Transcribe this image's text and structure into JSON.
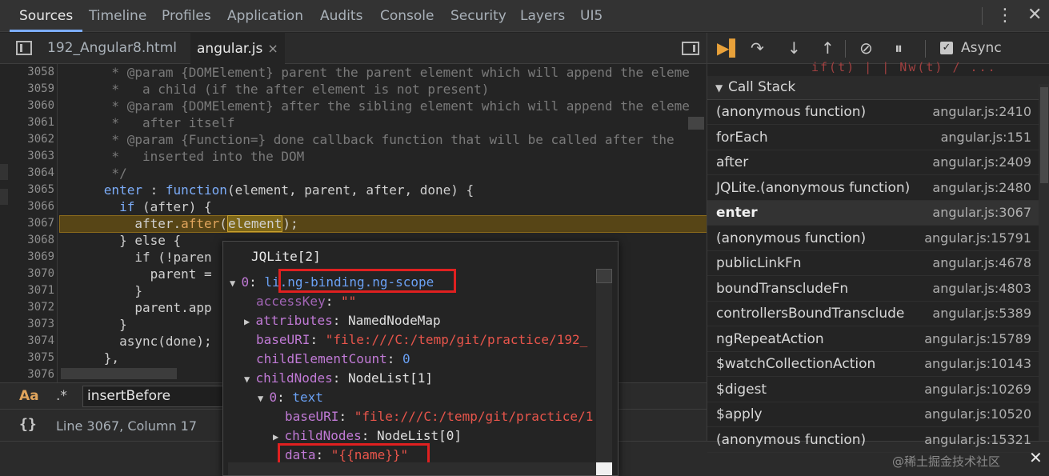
{
  "top_tabs": [
    "Sources",
    "Timeline",
    "Profiles",
    "Application",
    "Audits",
    "Console",
    "Security",
    "Layers",
    "UI5"
  ],
  "top_bar": {
    "menu_icon": "kebab-icon",
    "close_icon": "close-icon"
  },
  "editor": {
    "tabs": [
      {
        "label": "192_Angular8.html"
      },
      {
        "label": "angular.js",
        "close": "×"
      }
    ],
    "lines": [
      {
        "num": "3058",
        "text": "       * @param {DOMElement} parent the parent element which will append the eleme"
      },
      {
        "num": "3059",
        "text": "       *   a child (if the after element is not present)"
      },
      {
        "num": "3060",
        "text": "       * @param {DOMElement} after the sibling element which will append the eleme"
      },
      {
        "num": "3061",
        "text": "       *   after itself"
      },
      {
        "num": "3062",
        "text": "       * @param {Function=} done callback function that will be called after the"
      },
      {
        "num": "3063",
        "text": "       *   inserted into the DOM"
      },
      {
        "num": "3064",
        "text": "       */"
      },
      {
        "num": "3065",
        "text": ""
      },
      {
        "num": "3066",
        "text": ""
      },
      {
        "num": "3067",
        "text": ""
      },
      {
        "num": "3068",
        "text": "        } else {"
      },
      {
        "num": "3069",
        "text": "          if (!paren"
      },
      {
        "num": "3070",
        "text": "            parent ="
      },
      {
        "num": "3071",
        "text": "          }"
      },
      {
        "num": "3072",
        "text": "          parent.app"
      },
      {
        "num": "3073",
        "text": "        }"
      },
      {
        "num": "3074",
        "text": "        async(done);"
      },
      {
        "num": "3075",
        "text": "      },"
      },
      {
        "num": "3076",
        "text": ""
      }
    ],
    "line_3065": {
      "indent": "      ",
      "name": "enter",
      "sep": " : ",
      "kw": "function",
      "args": "(element, parent, after, done) {"
    },
    "line_3066": {
      "indent": "        ",
      "kw": "if",
      "rest": " (after) {"
    },
    "line_3067": {
      "indent": "          ",
      "obj": "after.",
      "method": "after",
      "open": "(",
      "arg": "element",
      "close": ");"
    }
  },
  "search": {
    "case_label": "Aa",
    "regex_label": ".*",
    "value": "insertBefore"
  },
  "status": {
    "braces": "{}",
    "cursor": "Line 3067, Column 17"
  },
  "debugger": {
    "async_label": "Async",
    "async_checked": "✓",
    "cut_off_text": "if(t) | | Nw(t) / ...",
    "call_stack_title": "Call Stack",
    "frames": [
      {
        "name": "(anonymous function)",
        "loc": "angular.js:2410"
      },
      {
        "name": "forEach",
        "loc": "angular.js:151"
      },
      {
        "name": "after",
        "loc": "angular.js:2409"
      },
      {
        "name": "JQLite.(anonymous function)",
        "loc": "angular.js:2480"
      },
      {
        "name": "enter",
        "loc": "angular.js:3067",
        "selected": true
      },
      {
        "name": "(anonymous function)",
        "loc": "angular.js:15791"
      },
      {
        "name": "publicLinkFn",
        "loc": "angular.js:4678"
      },
      {
        "name": "boundTranscludeFn",
        "loc": "angular.js:4803"
      },
      {
        "name": "controllersBoundTransclude",
        "loc": "angular.js:5389"
      },
      {
        "name": "ngRepeatAction",
        "loc": "angular.js:15789"
      },
      {
        "name": "$watchCollectionAction",
        "loc": "angular.js:10143"
      },
      {
        "name": "$digest",
        "loc": "angular.js:10269"
      },
      {
        "name": "$apply",
        "loc": "angular.js:10520"
      },
      {
        "name": "(anonymous function)",
        "loc": "angular.js:15321"
      }
    ]
  },
  "popover": {
    "title": "JQLite[2]",
    "rows": {
      "r0": {
        "key": "0",
        "colon": ": ",
        "val": "li.ng-binding.ng-scope"
      },
      "r1": {
        "key": "accessKey",
        "colon": ": ",
        "val": "\"\""
      },
      "r2": {
        "key": "attributes",
        "colon": ": ",
        "val": "NamedNodeMap"
      },
      "r3": {
        "key": "baseURI",
        "colon": ": ",
        "val": "\"file:///C:/temp/git/practice/192_"
      },
      "r4": {
        "key": "childElementCount",
        "colon": ": ",
        "val": "0"
      },
      "r5": {
        "key": "childNodes",
        "colon": ": ",
        "val": "NodeList[1]"
      },
      "r6": {
        "key": "0",
        "colon": ": ",
        "val": "text"
      },
      "r7": {
        "key": "baseURI",
        "colon": ": ",
        "val": "\"file:///C:/temp/git/practice/1"
      },
      "r8": {
        "key": "childNodes",
        "colon": ": ",
        "val": "NodeList[0]"
      },
      "r9": {
        "key": "data",
        "colon": ": ",
        "val": "\"{{name}}\""
      }
    }
  },
  "watermark": "@稀土掘金技术社区",
  "colors": {
    "accent": "#7cacf8",
    "highlight": "#574516",
    "annotation": "#e02020"
  }
}
